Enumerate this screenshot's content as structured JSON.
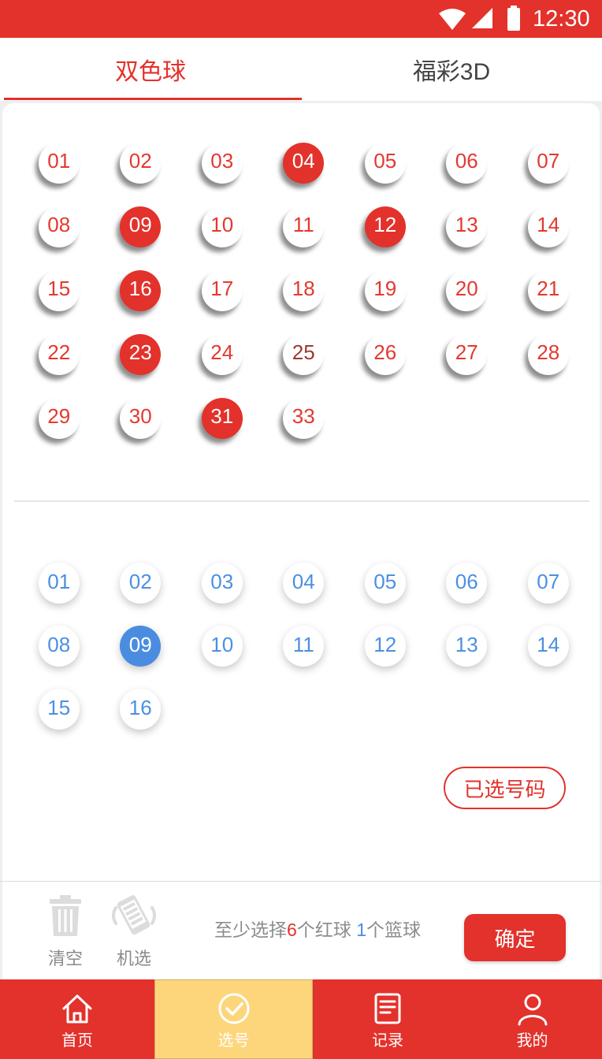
{
  "colors": {
    "primary_red": "#E3312B",
    "blue": "#4A8DE0",
    "nav_active_bg": "#FDD67C",
    "muted_gray": "#8C8C8C"
  },
  "status_bar": {
    "time": "12:30",
    "icons": [
      "wifi-icon",
      "signal-icon",
      "battery-icon"
    ]
  },
  "tabs": [
    {
      "label": "双色球",
      "active": true
    },
    {
      "label": "福彩3D",
      "active": false
    }
  ],
  "red_balls": [
    {
      "number": "01",
      "selected": false
    },
    {
      "number": "02",
      "selected": false
    },
    {
      "number": "03",
      "selected": false
    },
    {
      "number": "04",
      "selected": true
    },
    {
      "number": "05",
      "selected": false
    },
    {
      "number": "06",
      "selected": false
    },
    {
      "number": "07",
      "selected": false
    },
    {
      "number": "08",
      "selected": false
    },
    {
      "number": "09",
      "selected": true
    },
    {
      "number": "10",
      "selected": false
    },
    {
      "number": "11",
      "selected": false
    },
    {
      "number": "12",
      "selected": true
    },
    {
      "number": "13",
      "selected": false
    },
    {
      "number": "14",
      "selected": false
    },
    {
      "number": "15",
      "selected": false
    },
    {
      "number": "16",
      "selected": true
    },
    {
      "number": "17",
      "selected": false
    },
    {
      "number": "18",
      "selected": false
    },
    {
      "number": "19",
      "selected": false
    },
    {
      "number": "20",
      "selected": false
    },
    {
      "number": "21",
      "selected": false
    },
    {
      "number": "22",
      "selected": false
    },
    {
      "number": "23",
      "selected": true
    },
    {
      "number": "24",
      "selected": false
    },
    {
      "number": "25",
      "selected": false,
      "text_color": "#9B3A32"
    },
    {
      "number": "26",
      "selected": false
    },
    {
      "number": "27",
      "selected": false
    },
    {
      "number": "28",
      "selected": false
    },
    {
      "number": "29",
      "selected": false
    },
    {
      "number": "30",
      "selected": false
    },
    {
      "number": "31",
      "selected": true
    },
    {
      "number": "33",
      "selected": false
    }
  ],
  "blue_balls": [
    {
      "number": "01",
      "selected": false
    },
    {
      "number": "02",
      "selected": false
    },
    {
      "number": "03",
      "selected": false
    },
    {
      "number": "04",
      "selected": false
    },
    {
      "number": "05",
      "selected": false
    },
    {
      "number": "06",
      "selected": false
    },
    {
      "number": "07",
      "selected": false
    },
    {
      "number": "08",
      "selected": false
    },
    {
      "number": "09",
      "selected": true
    },
    {
      "number": "10",
      "selected": false
    },
    {
      "number": "11",
      "selected": false
    },
    {
      "number": "12",
      "selected": false
    },
    {
      "number": "13",
      "selected": false
    },
    {
      "number": "14",
      "selected": false
    },
    {
      "number": "15",
      "selected": false
    },
    {
      "number": "16",
      "selected": false
    }
  ],
  "selected_numbers_button": "已选号码",
  "actions": {
    "clear": {
      "label": "清空",
      "icon": "trash-icon"
    },
    "random": {
      "label": "机选",
      "icon": "shake-phone-icon"
    },
    "hint": {
      "prefix": "至少选择",
      "red_count": "6",
      "middle": "个红球 ",
      "blue_count": "1",
      "suffix": "个篮球"
    },
    "confirm_label": "确定"
  },
  "nav": [
    {
      "label": "首页",
      "icon": "home-icon",
      "active": false
    },
    {
      "label": "选号",
      "icon": "check-circle-icon",
      "active": true
    },
    {
      "label": "记录",
      "icon": "document-icon",
      "active": false
    },
    {
      "label": "我的",
      "icon": "user-icon",
      "active": false
    }
  ]
}
